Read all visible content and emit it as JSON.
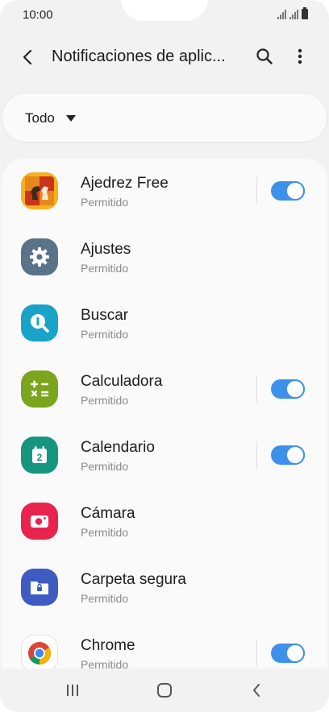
{
  "status_bar": {
    "time": "10:00"
  },
  "header": {
    "title": "Notificaciones de aplic..."
  },
  "filter": {
    "selected": "Todo"
  },
  "apps": [
    {
      "name": "Ajedrez Free",
      "status": "Permitido",
      "has_toggle": true,
      "icon": "chess-icon"
    },
    {
      "name": "Ajustes",
      "status": "Permitido",
      "has_toggle": false,
      "icon": "settings-gear-icon"
    },
    {
      "name": "Buscar",
      "status": "Permitido",
      "has_toggle": false,
      "icon": "search-app-icon"
    },
    {
      "name": "Calculadora",
      "status": "Permitido",
      "has_toggle": true,
      "icon": "calculator-icon"
    },
    {
      "name": "Calendario",
      "status": "Permitido",
      "has_toggle": true,
      "icon": "calendar-icon"
    },
    {
      "name": "Cámara",
      "status": "Permitido",
      "has_toggle": false,
      "icon": "camera-icon"
    },
    {
      "name": "Carpeta segura",
      "status": "Permitido",
      "has_toggle": false,
      "icon": "secure-folder-icon"
    },
    {
      "name": "Chrome",
      "status": "Permitido",
      "has_toggle": true,
      "icon": "chrome-icon"
    }
  ],
  "calendar_icon_day": "2",
  "colors": {
    "toggle_on": "#3e91ea",
    "background": "#f2f2f2",
    "card": "#fafafa"
  }
}
